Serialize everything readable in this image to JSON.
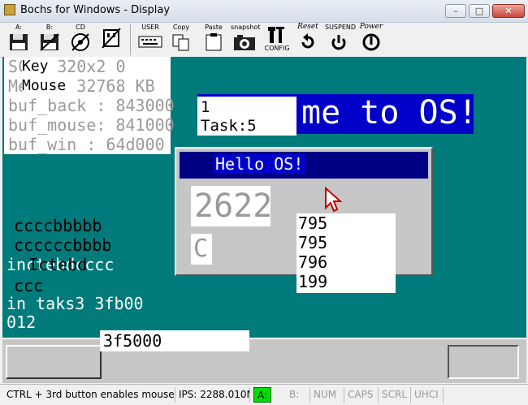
{
  "window": {
    "title": "Bochs for Windows - Display",
    "minimize_glyph": "–",
    "maximize_glyph": "□",
    "close_glyph": "✕"
  },
  "toolbar": {
    "floppy_a": "A:",
    "floppy_b": "B:",
    "cdrom": "CD",
    "user": "USER",
    "copy": "Copy",
    "paste": "Paste",
    "snapshot": "snapshot",
    "config": "CONFIG",
    "reset": "Reset",
    "suspend": "SUSPEND",
    "power": "Power"
  },
  "display": {
    "debug_lines": [
      "buf_back : 843000",
      "buf_mouse: 841000",
      "buf_win  : 64d000"
    ],
    "scrn_line": "SCRN 320x2 0",
    "mem_line": "Memory 32768 KB",
    "key_label": "Key",
    "mouse_label": "Mouse",
    "banner_text": "me to OS!",
    "task_line1": "1",
    "task_line2": "Task:5",
    "hello_title": "Hello OS!",
    "counter": "2622",
    "c_char": "C",
    "numbers": [
      "795",
      "795",
      "796",
      "199"
    ],
    "console_lines": [
      "ccccbbbbb",
      "ccccccbbbb",
      "ccc"
    ],
    "console_overlap_white": "inctebdcccc",
    "console_overlap_black": "Ictebd",
    "taks_line": "in taks3  3fb00",
    "num_line": "012",
    "addr": "3f5000"
  },
  "statusbar": {
    "hint": "CTRL + 3rd button enables mouse",
    "ips": "IPS: 2288.010M",
    "a_led": "A:",
    "b_led": "B:",
    "num": "NUM",
    "caps": "CAPS",
    "scrl": "SCRL",
    "uhci": "UHCI"
  },
  "colors": {
    "desktop": "#007a7a",
    "banner": "#0000c8",
    "a_led_green": "#00e000"
  }
}
